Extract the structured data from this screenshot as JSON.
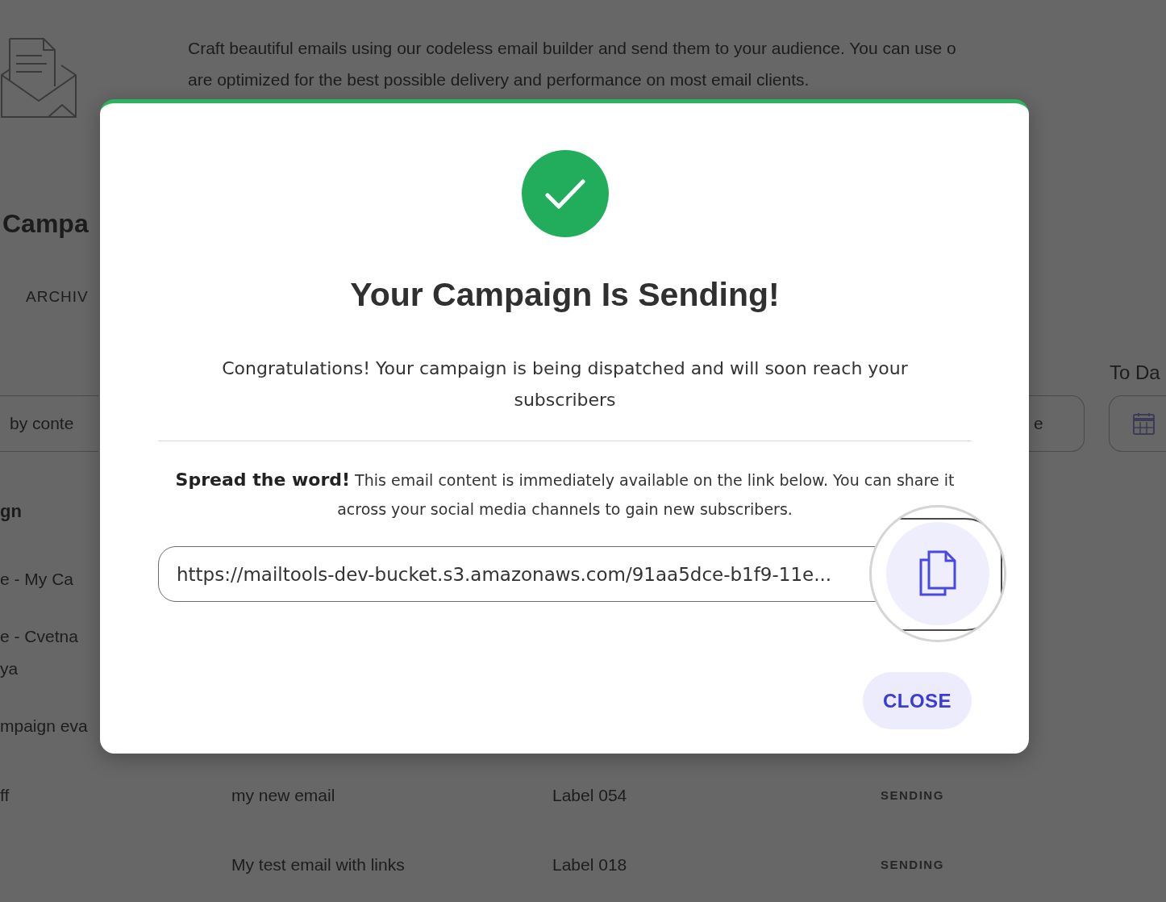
{
  "background_page": {
    "intro_lines": [
      "Craft beautiful emails using our codeless email builder and send them to your audience. You can use o",
      "are optimized for the best possible delivery and performance on most email clients."
    ],
    "heading": "Campa",
    "tab": "ARCHIV",
    "search": {
      "placeholder": "by conte"
    },
    "from_field": {
      "placeholder": "e"
    },
    "to_field": {
      "label": "To Da"
    },
    "table": {
      "columns": [
        "gn"
      ],
      "rows": [
        {
          "column_1": [
            "e - My Ca"
          ]
        },
        {
          "column_1": [
            "e - Cvetna",
            "ya"
          ]
        },
        {
          "column_1": [
            "mpaign eva"
          ]
        },
        {
          "column_1": [
            "ff"
          ],
          "column_2": "my new email",
          "column_3": "Label 054",
          "status": "SENDING"
        },
        {
          "column_2": "My test email with links",
          "column_3": "Label 018",
          "status": "SENDING"
        }
      ]
    }
  },
  "modal": {
    "title": "Your Campaign Is Sending!",
    "message": "Congratulations! Your campaign is being dispatched and will soon reach your subscribers",
    "share_text": "**Spread the word!** This email content is immediately available on the link below. You can share it across your social media channels to gain new subscribers.",
    "share_link": {
      "value": "https://mailtools-dev-bucket.s3.amazonaws.com/91aa5dce-b1f9-11e..."
    },
    "buttons": [
      {
        "label": "CLOSE"
      }
    ]
  }
}
